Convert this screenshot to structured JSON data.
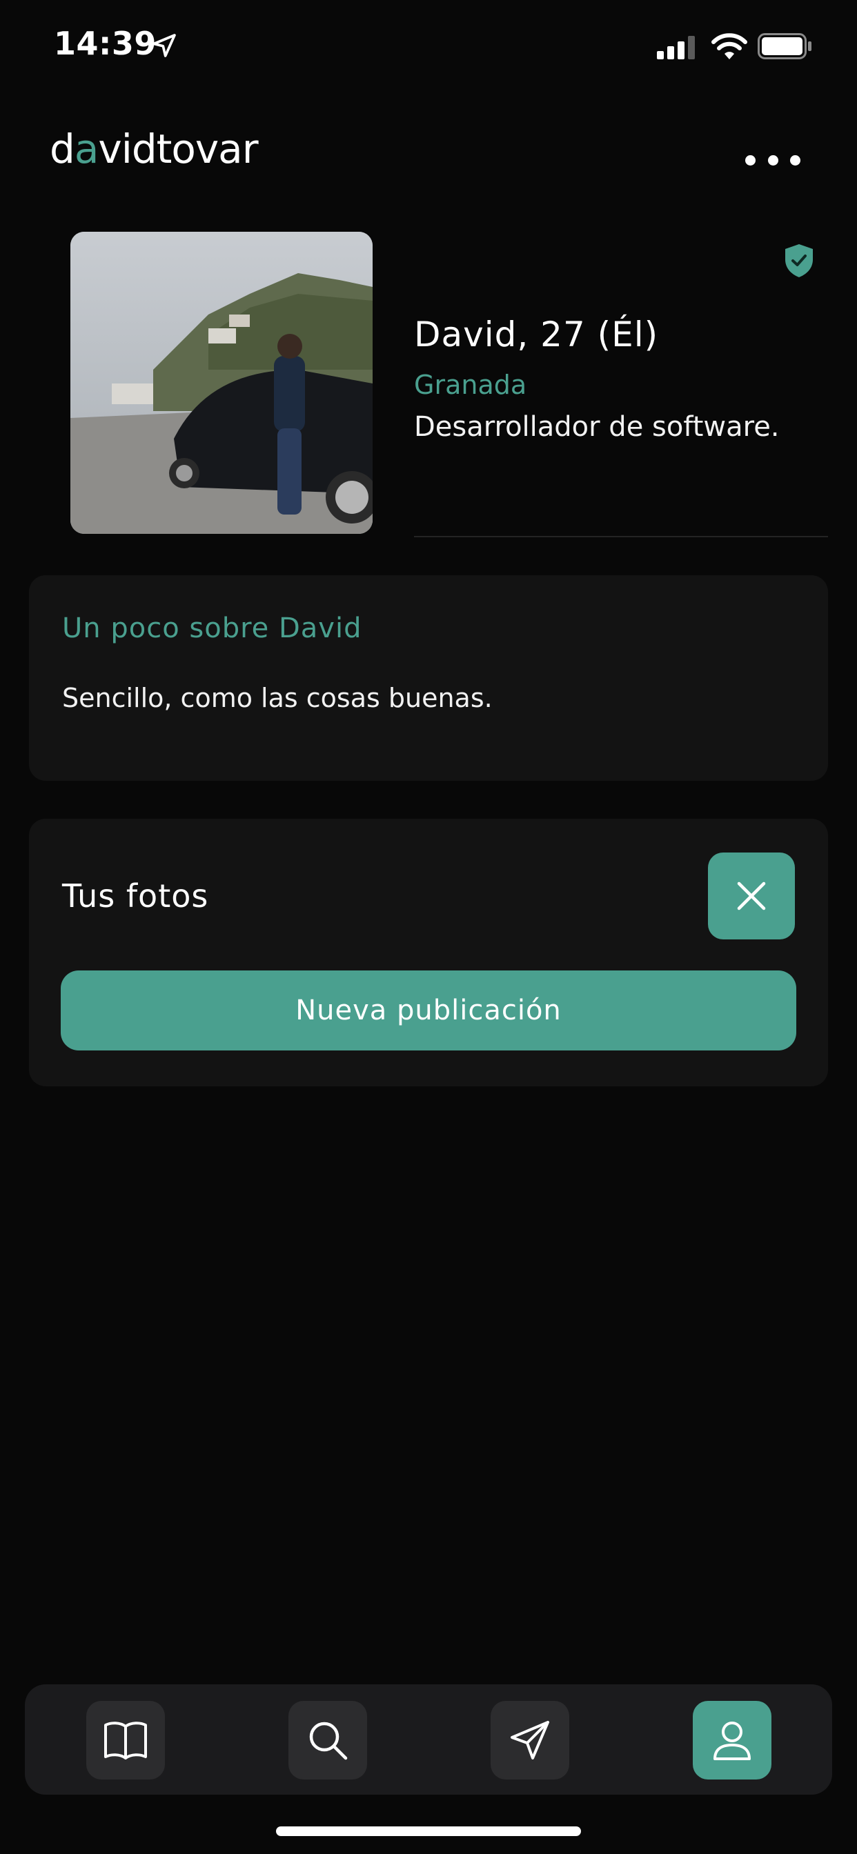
{
  "status_bar": {
    "time": "14:39"
  },
  "header": {
    "brand_part1": "d",
    "brand_accent": "a",
    "brand_part2": "vidtovar",
    "more_icon": "more-horizontal-icon"
  },
  "profile": {
    "name_age": "David, 27 (Él)",
    "city": "Granada",
    "occupation": "Desarrollador de software.",
    "verified_icon": "verified-shield-icon"
  },
  "about": {
    "title": "Un poco sobre David",
    "text": "Sencillo, como las cosas buenas."
  },
  "photos": {
    "title": "Tus fotos",
    "new_post_label": "Nueva publicación"
  },
  "tab_bar": {
    "items": [
      {
        "icon": "book-icon",
        "active": false
      },
      {
        "icon": "search-icon",
        "active": false
      },
      {
        "icon": "send-icon",
        "active": false
      },
      {
        "icon": "user-icon",
        "active": true
      }
    ]
  },
  "colors": {
    "accent": "#4aa08f",
    "background": "#080808",
    "card": "#131313"
  }
}
